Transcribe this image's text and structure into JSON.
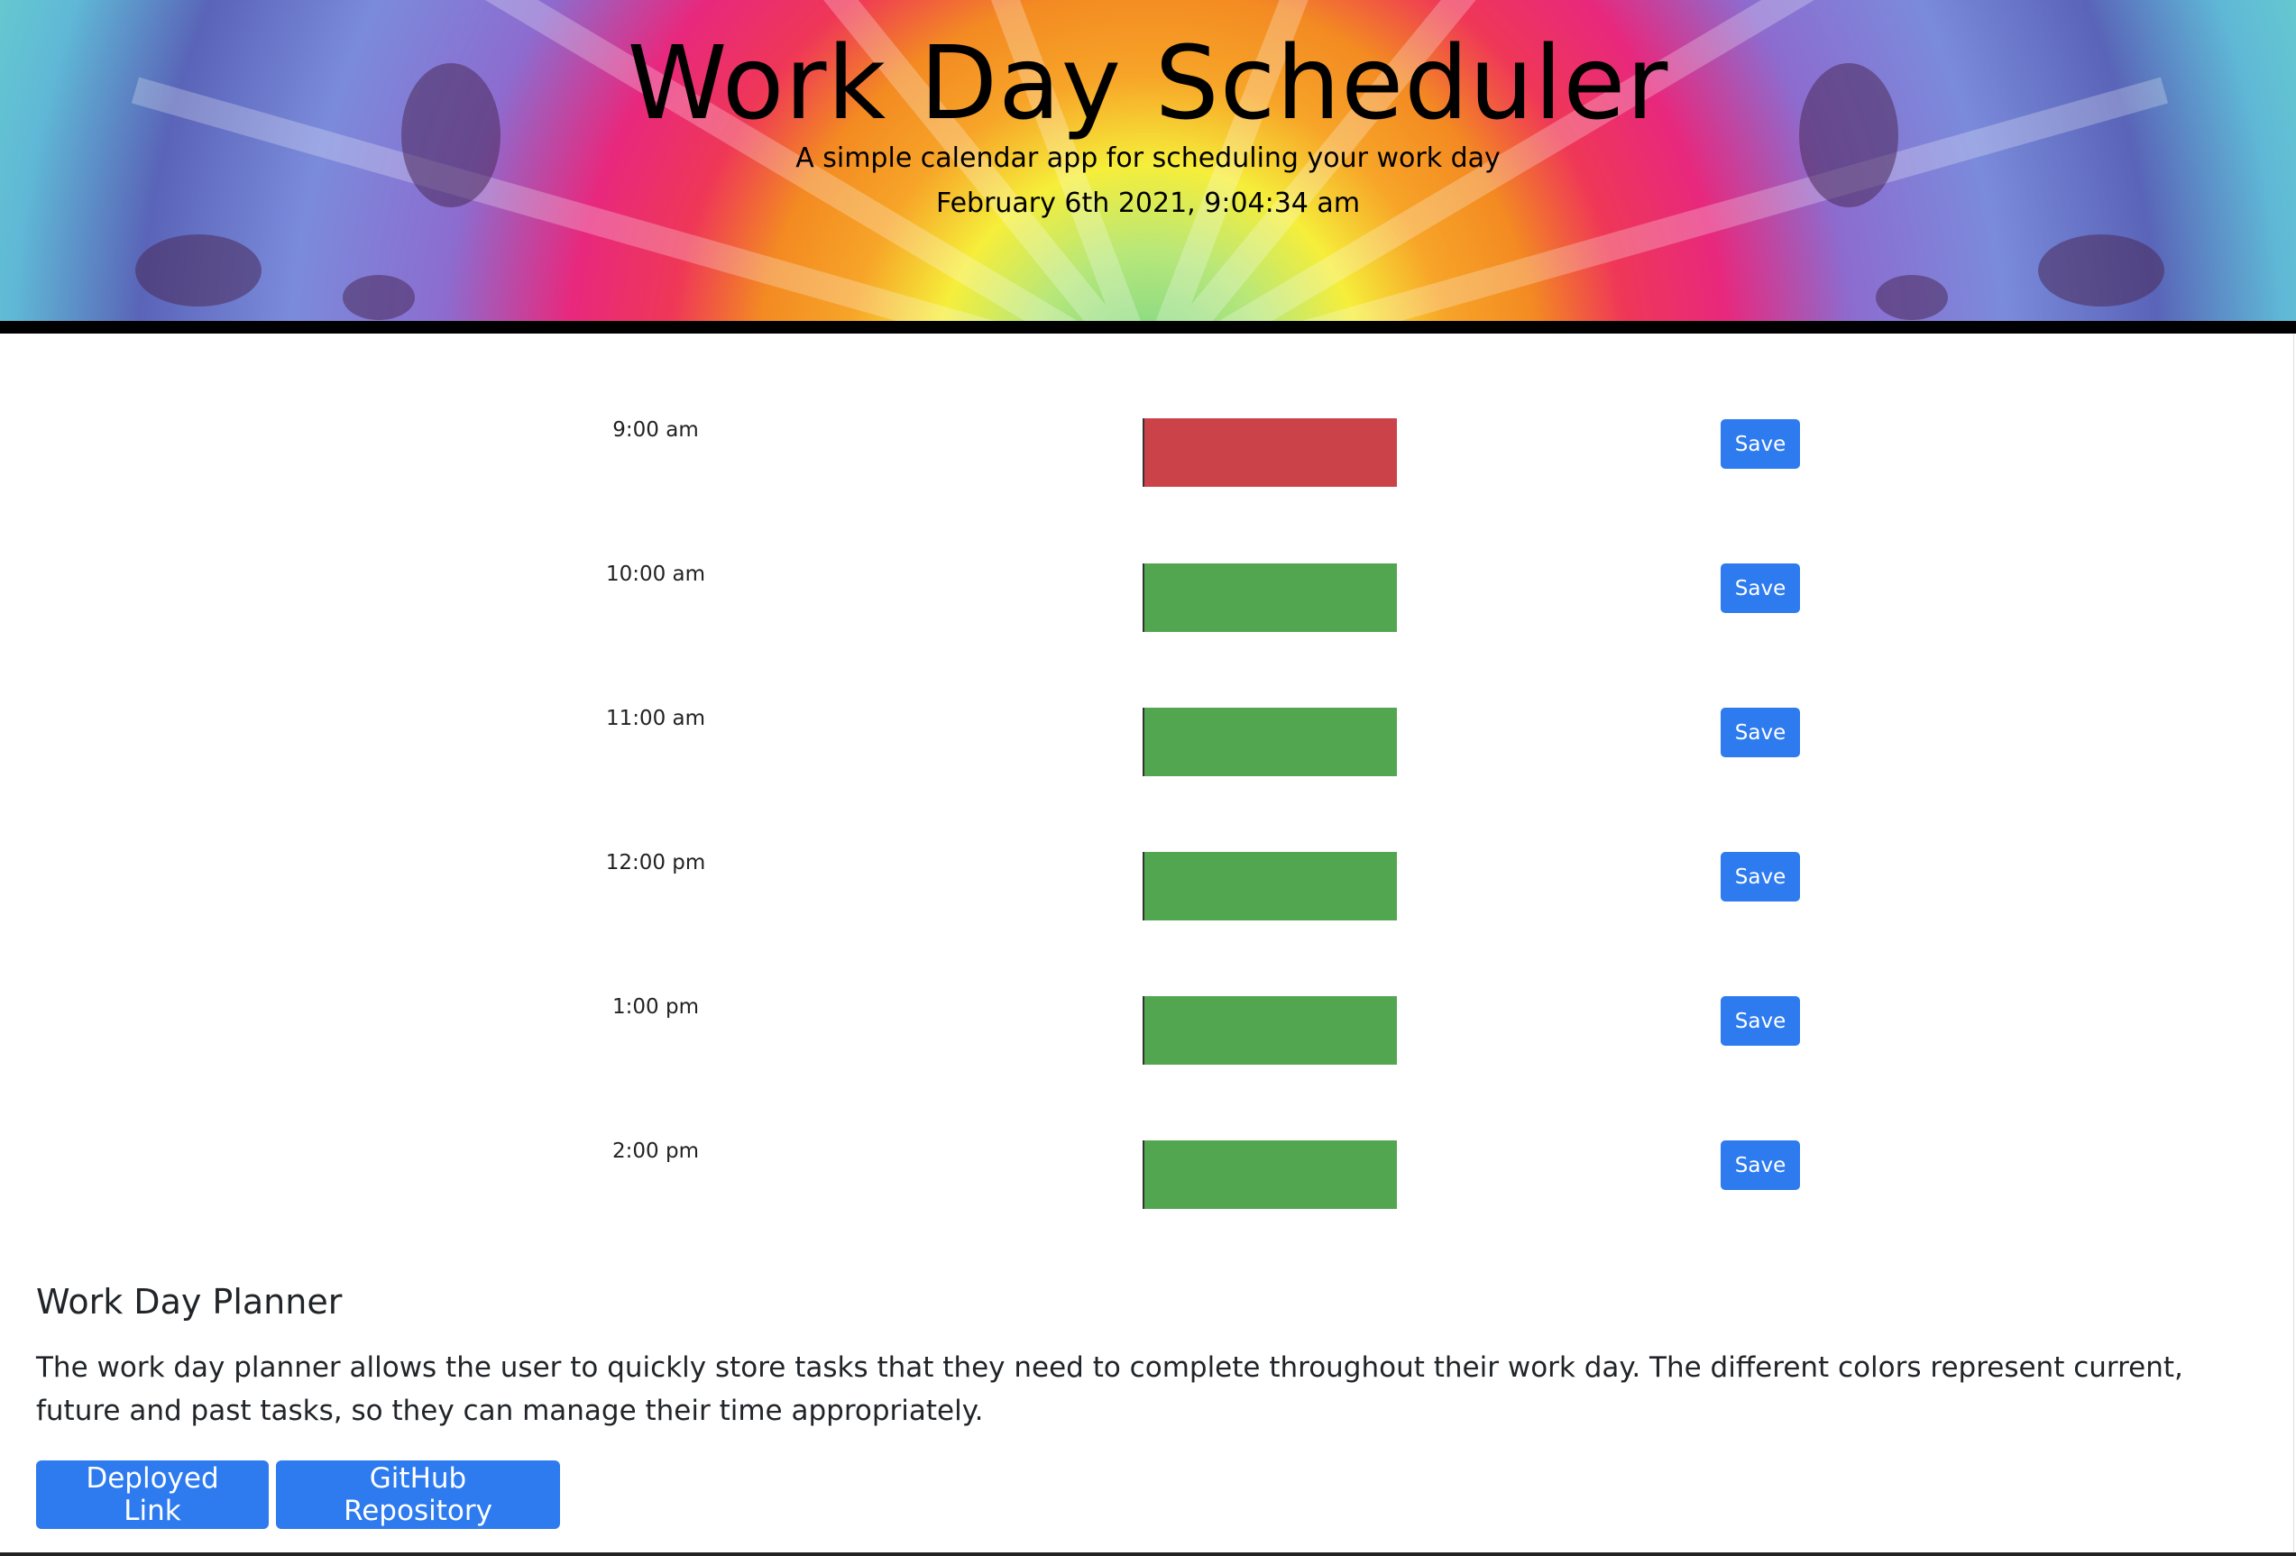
{
  "header": {
    "title": "Work Day Scheduler",
    "subtitle": "A simple calendar app for scheduling your work day",
    "datetime": "February 6th 2021, 9:04:34 am"
  },
  "colors": {
    "past": "#cc4249",
    "future": "#52a650",
    "button": "#2d7bef",
    "header_border": "#000000"
  },
  "schedule": [
    {
      "hour": "9:00 am",
      "status": "past",
      "text": "",
      "save_label": "Save"
    },
    {
      "hour": "10:00 am",
      "status": "future",
      "text": "",
      "save_label": "Save"
    },
    {
      "hour": "11:00 am",
      "status": "future",
      "text": "",
      "save_label": "Save"
    },
    {
      "hour": "12:00 pm",
      "status": "future",
      "text": "",
      "save_label": "Save"
    },
    {
      "hour": "1:00 pm",
      "status": "future",
      "text": "",
      "save_label": "Save"
    },
    {
      "hour": "2:00 pm",
      "status": "future",
      "text": "",
      "save_label": "Save"
    }
  ],
  "planner": {
    "heading": "Work Day Planner",
    "description": "The work day planner allows the user to quickly store tasks that they need to complete throughout their work day. The different colors represent current, future and past tasks, so they can manage their time appropriately.",
    "deployed_label": "Deployed Link",
    "github_label": "GitHub Repository"
  }
}
